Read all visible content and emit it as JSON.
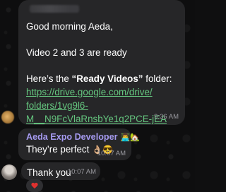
{
  "messages": [
    {
      "lines": [
        "Good morning Aeda,",
        "Video 2 and 3 are ready",
        "Here’s the",
        "“Ready Videos”",
        "folder:"
      ],
      "link_lines": [
        "https://drive.google.com/drive/",
        "folders/1vg9l6-",
        "M__N9FcVlaRnsbYe1q2PCE-jEA"
      ],
      "time": "9:36 AM"
    },
    {
      "sender": "Aeda Expo Developer",
      "sender_emoji": "👨‍💻🏡",
      "text": "They’re perfect",
      "emoji": "👌🏼😎",
      "time": "10:07 AM"
    },
    {
      "text": "Thank you",
      "time": "10:07 AM",
      "reaction": "heart-icon"
    }
  ],
  "colors": {
    "bubble": "#262628",
    "link": "#65c67f",
    "sender": "#a59aef",
    "reaction": "#e0312f"
  }
}
